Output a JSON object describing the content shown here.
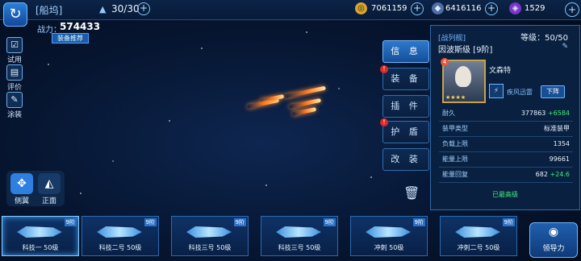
{
  "topbar": {
    "title": "[船坞]",
    "fleet_count": "30/30",
    "credits": "7061159",
    "alloy": "6416116",
    "crystal": "1529"
  },
  "power": {
    "label": "战力：",
    "value": "574433",
    "equip_recommend": "装备推荐"
  },
  "side_buttons": {
    "trial": "试用",
    "review": "评价",
    "paint": "涂装"
  },
  "view_buttons": {
    "side": "侧翼",
    "front": "正面"
  },
  "tabs": [
    "信 息",
    "装 备",
    "插 件",
    "护 盾",
    "改 装"
  ],
  "info": {
    "class": "[战列舰]",
    "ship_name": "因波斯级 [9阶]",
    "level": "等级：50/50",
    "captain": "文森特",
    "skill": "疾风迅雷",
    "unequip": "下阵",
    "portrait_badge": "4",
    "stars": "★★★★",
    "stats": [
      {
        "k": "耐久",
        "v": "377863",
        "bonus": "+6584"
      },
      {
        "k": "装甲类型",
        "v": "标准装甲",
        "bonus": ""
      },
      {
        "k": "负载上限",
        "v": "1354",
        "bonus": ""
      },
      {
        "k": "能量上限",
        "v": "99661",
        "bonus": ""
      },
      {
        "k": "能量回复",
        "v": "682",
        "bonus": "+24.6"
      }
    ],
    "max_level": "已最高级"
  },
  "ships": [
    {
      "label": "科技一 50级",
      "tier": "9阶"
    },
    {
      "label": "科技二号 50级",
      "tier": "9阶"
    },
    {
      "label": "科技三号 50级",
      "tier": "9阶"
    },
    {
      "label": "科技三号 50级",
      "tier": "9阶"
    },
    {
      "label": "冲刺 50级",
      "tier": "9阶"
    },
    {
      "label": "冲刺二号 50级",
      "tier": "9阶"
    }
  ],
  "lead_button": "领导力",
  "colors": {
    "accent": "#2d79cc",
    "bonus": "#3cf07a",
    "gold_frame": "#c9a14c"
  },
  "icons": [
    "back-icon",
    "ship-icon",
    "coin-icon",
    "alloy-icon",
    "crystal-icon",
    "trash-icon",
    "wing-icon",
    "front-icon",
    "lead-icon"
  ]
}
